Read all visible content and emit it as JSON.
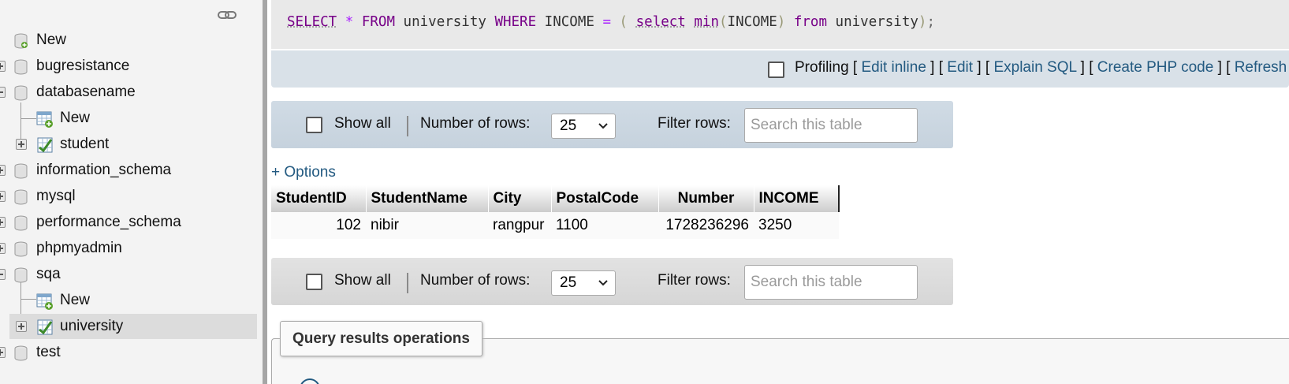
{
  "navigation": {
    "tree": [
      {
        "label": "New",
        "type": "new-db"
      },
      {
        "label": "bugresistance",
        "type": "database"
      },
      {
        "label": "databasename",
        "type": "database",
        "expanded": true
      },
      {
        "label": "New",
        "type": "new-table"
      },
      {
        "label": "student",
        "type": "table"
      },
      {
        "label": "information_schema",
        "type": "database"
      },
      {
        "label": "mysql",
        "type": "database"
      },
      {
        "label": "performance_schema",
        "type": "database"
      },
      {
        "label": "phpmyadmin",
        "type": "database"
      },
      {
        "label": "sqa",
        "type": "database",
        "expanded": true
      },
      {
        "label": "New",
        "type": "new-table"
      },
      {
        "label": "university",
        "type": "table",
        "selected": true
      },
      {
        "label": "test",
        "type": "database"
      }
    ]
  },
  "sql_query": {
    "tokens": [
      {
        "text": "SELECT",
        "kind": "fn"
      },
      {
        "text": " ",
        "kind": "id"
      },
      {
        "text": "*",
        "kind": "op"
      },
      {
        "text": " ",
        "kind": "id"
      },
      {
        "text": "FROM",
        "kind": "kw"
      },
      {
        "text": " university ",
        "kind": "id"
      },
      {
        "text": "WHERE",
        "kind": "kw"
      },
      {
        "text": " INCOME ",
        "kind": "id"
      },
      {
        "text": "=",
        "kind": "op"
      },
      {
        "text": " ",
        "kind": "id"
      },
      {
        "text": "(",
        "kind": "br"
      },
      {
        "text": " ",
        "kind": "id"
      },
      {
        "text": "select",
        "kind": "fn"
      },
      {
        "text": " ",
        "kind": "id"
      },
      {
        "text": "min",
        "kind": "fn"
      },
      {
        "text": "(",
        "kind": "br"
      },
      {
        "text": "INCOME",
        "kind": "id"
      },
      {
        "text": ")",
        "kind": "br"
      },
      {
        "text": " ",
        "kind": "id"
      },
      {
        "text": "from",
        "kind": "kw"
      },
      {
        "text": " university",
        "kind": "id"
      },
      {
        "text": ")",
        "kind": "br"
      },
      {
        "text": ";",
        "kind": "pu"
      }
    ]
  },
  "profiling": {
    "label": "Profiling",
    "checked": false,
    "links": [
      "Edit inline",
      "Edit",
      "Explain SQL",
      "Create PHP code",
      "Refresh"
    ]
  },
  "table_nav": {
    "show_all_label": "Show all",
    "rows_label": "Number of rows:",
    "rows_value": "25",
    "filter_label": "Filter rows:",
    "filter_placeholder": "Search this table"
  },
  "options_link": "+ Options",
  "results": {
    "columns": [
      "StudentID",
      "StudentName",
      "City",
      "PostalCode",
      "Number",
      "INCOME"
    ],
    "rows": [
      [
        "102",
        "nibir",
        "rangpur",
        "1100",
        "1728236296",
        "3250"
      ]
    ]
  },
  "query_results_operations": {
    "title": "Query results operations"
  },
  "colors": {
    "link": "#235a81",
    "keyword": "#770088",
    "nav_background": "#f3f3f3",
    "nav_bar_top": "#c6d2dd"
  }
}
